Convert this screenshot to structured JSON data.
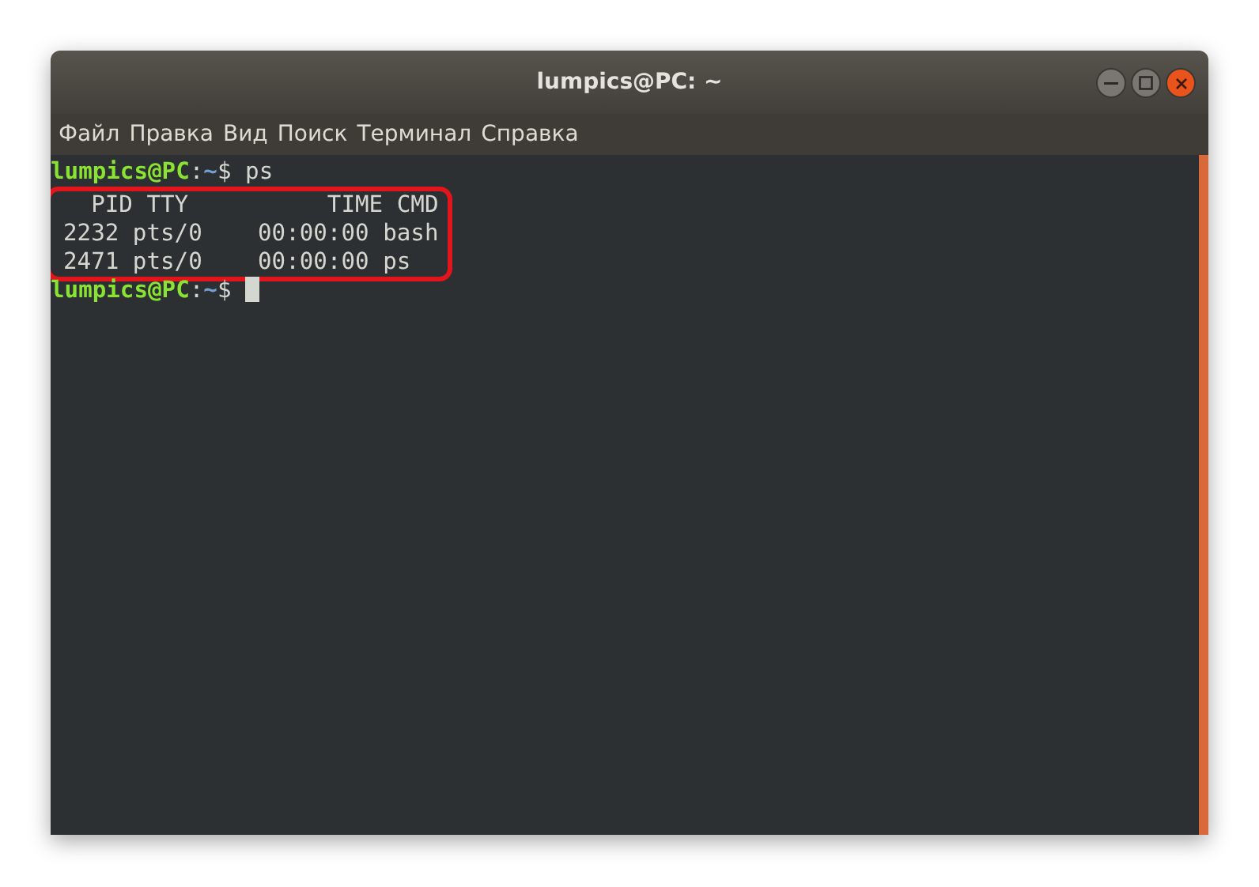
{
  "window": {
    "title": "lumpics@PC: ~"
  },
  "menu": [
    "Файл",
    "Правка",
    "Вид",
    "Поиск",
    "Терминал",
    "Справка"
  ],
  "terminal": {
    "blocks": [
      {
        "kind": "prompt",
        "user": "lumpics@PC",
        "sep": ":",
        "path": "~",
        "symbol": "$",
        "command": "ps",
        "cursor": false
      },
      {
        "kind": "output",
        "highlighted": true,
        "lines": [
          "  PID TTY          TIME CMD",
          "2232 pts/0    00:00:00 bash",
          "2471 pts/0    00:00:00 ps"
        ]
      },
      {
        "kind": "prompt",
        "user": "lumpics@PC",
        "sep": ":",
        "path": "~",
        "symbol": "$",
        "cursor": true
      }
    ]
  }
}
